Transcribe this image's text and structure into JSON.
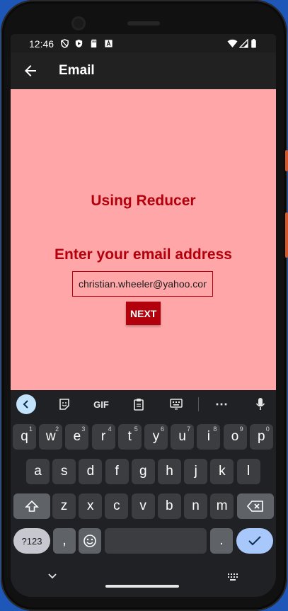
{
  "status_bar": {
    "time": "12:46",
    "icons": [
      "vpn-shield-icon",
      "play-protect-icon",
      "sd-card-icon",
      "font-a-icon",
      "wifi-icon",
      "signal-icon",
      "battery-icon"
    ]
  },
  "app_bar": {
    "title": "Email"
  },
  "content": {
    "heading": "Using Reducer",
    "prompt": "Enter your email address",
    "email_value": "christian.wheeler@yahoo.com",
    "next_label": "NEXT"
  },
  "colors": {
    "background": "#ffa7a8",
    "accent": "#b2000d",
    "app_bar": "#212121",
    "keyboard": "#202124"
  },
  "keyboard": {
    "toolbar": {
      "gif_label": "GIF",
      "more_label": "⋯"
    },
    "row1": [
      {
        "label": "q",
        "hint": "1"
      },
      {
        "label": "w",
        "hint": "2"
      },
      {
        "label": "e",
        "hint": "3"
      },
      {
        "label": "r",
        "hint": "4"
      },
      {
        "label": "t",
        "hint": "5"
      },
      {
        "label": "y",
        "hint": "6"
      },
      {
        "label": "u",
        "hint": "7"
      },
      {
        "label": "i",
        "hint": "8"
      },
      {
        "label": "o",
        "hint": "9"
      },
      {
        "label": "p",
        "hint": "0"
      }
    ],
    "row2": [
      "a",
      "s",
      "d",
      "f",
      "g",
      "h",
      "j",
      "k",
      "l"
    ],
    "row3": [
      "z",
      "x",
      "c",
      "v",
      "b",
      "n",
      "m"
    ],
    "symbols_label": "?123",
    "comma_label": ",",
    "period_label": "."
  }
}
